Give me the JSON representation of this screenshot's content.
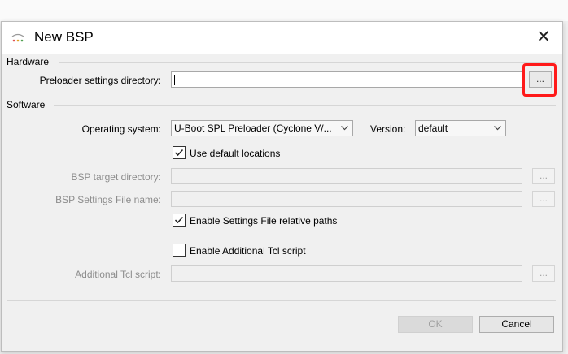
{
  "dialog": {
    "title": "New BSP",
    "close_glyph": "✕"
  },
  "hardware": {
    "section_label": "Hardware",
    "preloader_label": "Preloader settings directory:",
    "preloader_value": "",
    "browse_label": "..."
  },
  "software": {
    "section_label": "Software",
    "os_label": "Operating system:",
    "os_value": "U-Boot SPL Preloader (Cyclone V/...",
    "version_label": "Version:",
    "version_value": "default",
    "use_default_label": "Use default locations",
    "use_default_checked": true,
    "target_dir_label": "BSP target directory:",
    "target_dir_value": "",
    "settings_file_label": "BSP Settings File name:",
    "settings_file_value": "",
    "relative_paths_label": "Enable Settings File relative paths",
    "relative_paths_checked": true,
    "tcl_enable_label": "Enable Additional Tcl script",
    "tcl_enable_checked": false,
    "tcl_script_label": "Additional Tcl script:",
    "tcl_script_value": "",
    "browse_label": "..."
  },
  "buttons": {
    "ok": "OK",
    "cancel": "Cancel"
  },
  "colors": {
    "highlight": "#ff1a1a",
    "dialog_bg": "#f0f0f0"
  }
}
